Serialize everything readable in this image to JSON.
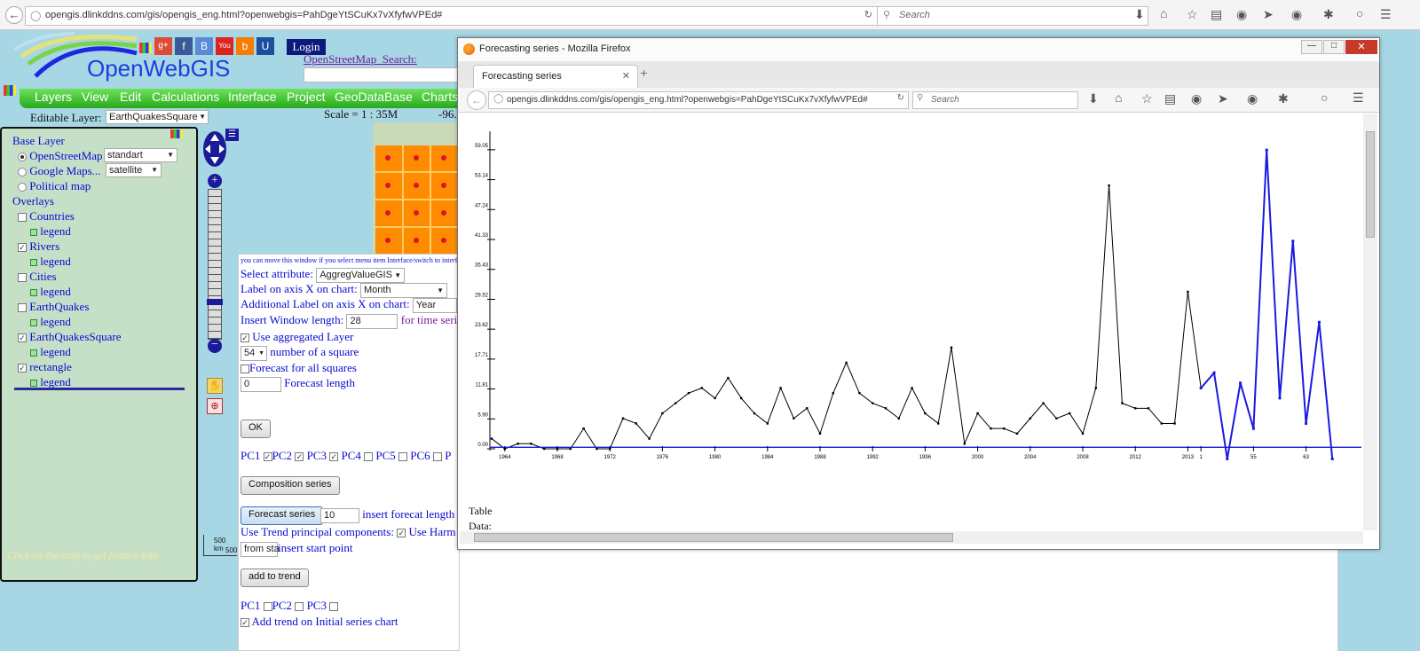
{
  "browser": {
    "url": "opengis.dlinkddns.com/gis/opengis_eng.html?openwebgis=PahDgeYtSCuKx7vXfyfwVPEd#",
    "search_placeholder": "Search"
  },
  "header": {
    "app_title": "OpenWebGIS",
    "login": "Login",
    "osm_search": "OpenStreetMap  Search:"
  },
  "menu": [
    "Layers",
    "View",
    "Edit",
    "Calculations",
    "Interface",
    "Project",
    "GeoDataBase",
    "Charts"
  ],
  "toolbar": {
    "editable_label": "Editable Layer:",
    "editable_value": "EarthQuakesSquare",
    "scale": "Scale = 1 : 35M",
    "coord": "-96."
  },
  "layers": {
    "base_title": "Base Layer",
    "osm": "OpenStreetMap",
    "osm_style": "standart",
    "google": "Google Maps...",
    "google_style": "satellite",
    "political": "Political map",
    "overlays_title": "Overlays",
    "legend": "legend",
    "items": [
      {
        "name": "Countries",
        "checked": false
      },
      {
        "name": "Rivers",
        "checked": true
      },
      {
        "name": "Cities",
        "checked": false
      },
      {
        "name": "EarthQuakes",
        "checked": false
      },
      {
        "name": "EarthQuakesSquare",
        "checked": true
      },
      {
        "name": "rectangle",
        "checked": true
      }
    ],
    "hint": "Click on the map to get feature info"
  },
  "scalebar": {
    "km": "500 km",
    "mi": "500"
  },
  "form": {
    "notice": "you can move this window if you select menu item Interface/switch to interface d",
    "select_attr_label": "Select attribute:",
    "select_attr_value": "AggregValueGIS",
    "axis_x_label": "Label on axis X on chart:",
    "axis_x_value": "Month",
    "add_label": "Additional Label on axis X on chart:",
    "add_value": "Year",
    "window_label": "Insert Window length:",
    "window_value": "28",
    "window_tail": "for time seri",
    "use_agg": "Use aggregated Layer",
    "square_value": "54",
    "square_label": "number of a square",
    "forecast_all": "Forecast for all squares",
    "forecast_len_value": "0",
    "forecast_len_label": "Forecast length",
    "ok": "OK",
    "pc_row": [
      "PC1",
      "PC2",
      "PC3",
      "PC4",
      "PC5",
      "PC6",
      "P"
    ],
    "composition": "Composition series",
    "forecast_btn": "Forecast series",
    "forecast_btn_value": "10",
    "forecast_btn_label": "insert forecat length",
    "trend_label": "Use Trend principal components:",
    "trend_tail": "Use Harm",
    "start_value": "from sta",
    "start_label": "insert start point",
    "add_trend": "add to trend",
    "pc_row2": [
      "PC1",
      "PC2",
      "PC3"
    ],
    "add_trend_chart": "Add trend on Initial series chart"
  },
  "popup": {
    "window_title": "Forecasting series - Mozilla Firefox",
    "tab": "Forecasting series",
    "url": "opengis.dlinkddns.com/gis/opengis_eng.html?openwebgis=PahDgeYtSCuKx7vXfyfwVPEd#",
    "search_placeholder": "Search",
    "table_label": "Table",
    "data_label": "Data:"
  },
  "chart_data": {
    "type": "line",
    "ylim": [
      0,
      62
    ],
    "y_ticks": [
      "0.00",
      "5.90",
      "11.81",
      "17.71",
      "23.62",
      "29.52",
      "35.43",
      "41.33",
      "47.24",
      "53.14",
      "59.05"
    ],
    "x_tick_labels": [
      "1964",
      "1968",
      "1972",
      "1976",
      "1980",
      "1984",
      "1988",
      "1992",
      "1996",
      "2000",
      "2004",
      "2008",
      "2012",
      "2013",
      "1",
      "55",
      "63"
    ],
    "series": [
      {
        "color": "#000000",
        "values": [
          2,
          0,
          1,
          1,
          0,
          0,
          0,
          4,
          0,
          0,
          6,
          5,
          2,
          7,
          9,
          11,
          12,
          10,
          14,
          10,
          7,
          5,
          12,
          6,
          8,
          3,
          11,
          17,
          11,
          9,
          8,
          6,
          12,
          7,
          5,
          20,
          1,
          7,
          4,
          4,
          3,
          6,
          9,
          6,
          7,
          3,
          12,
          52,
          9,
          8,
          8,
          5,
          5,
          31,
          12
        ]
      },
      {
        "color": "#1a1ae0",
        "values": [
          12,
          15,
          -2,
          13,
          4,
          59,
          10,
          41,
          5,
          25,
          -2
        ]
      },
      {
        "color": "#1a1ae0",
        "values": [
          0.3
        ]
      }
    ]
  }
}
